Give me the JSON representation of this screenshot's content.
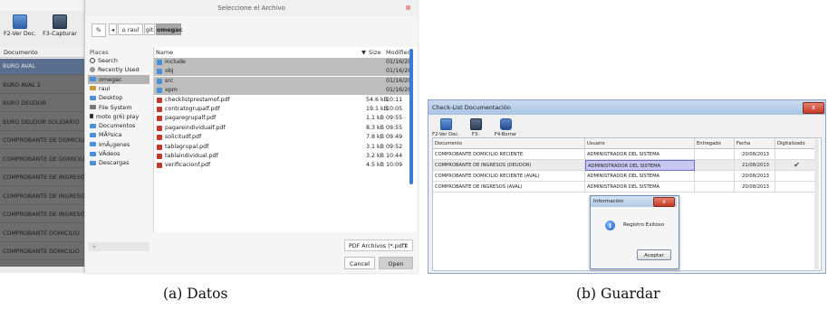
{
  "panel_a": {
    "app": {
      "toolbar": [
        {
          "label": "F2-Ver Doc.",
          "icon": "pdf-icon"
        },
        {
          "label": "F3-Capturar",
          "icon": "capture-icon"
        }
      ],
      "column": "Documento",
      "rows": [
        "BURO AVAL",
        "BURO AVAL 2",
        "BURO DEUDOR",
        "BURO DEUDOR SOLIDARIO",
        "COMPROBANTE DE DOMICILIO",
        "COMPROBANTE DE DOMICILIO",
        "COMPROBANTE DE INGRESOS",
        "COMPROBANTE DE INGRESOS",
        "COMPROBANTE DE INGRESOS",
        "COMPROBANTE DOMICILIO",
        "COMPROBANTE DOMICILIO"
      ],
      "selected_row": 0
    },
    "dialog": {
      "title": "Seleccione el Archivo",
      "breadcrumbs": [
        "raul",
        "git",
        "omegac"
      ],
      "places_header": "Places",
      "places": [
        {
          "label": "Search",
          "icon": "search-icon"
        },
        {
          "label": "Recently Used",
          "icon": "recent-icon"
        },
        {
          "label": "omegac",
          "icon": "folder-icon"
        },
        {
          "label": "raul",
          "icon": "home-icon"
        },
        {
          "label": "Desktop",
          "icon": "folder-icon"
        },
        {
          "label": "File System",
          "icon": "disk-icon"
        },
        {
          "label": "moto g(6) play",
          "icon": "phone-icon"
        },
        {
          "label": "Documentos",
          "icon": "folder-icon"
        },
        {
          "label": "MÃºsica",
          "icon": "folder-icon"
        },
        {
          "label": "ImÃ¡genes",
          "icon": "folder-icon"
        },
        {
          "label": "VÃ­deos",
          "icon": "folder-icon"
        },
        {
          "label": "Descargas",
          "icon": "folder-icon"
        }
      ],
      "selected_place": 2,
      "add_place": "+",
      "columns": {
        "name": "Name",
        "size": "Size",
        "modified": "Modified"
      },
      "files": [
        {
          "name": "include",
          "size": "",
          "modified": "01/16/20",
          "type": "dir"
        },
        {
          "name": "obj",
          "size": "",
          "modified": "01/16/20",
          "type": "dir"
        },
        {
          "name": "src",
          "size": "",
          "modified": "01/16/20",
          "type": "dir"
        },
        {
          "name": "xpm",
          "size": "",
          "modified": "01/16/20",
          "type": "dir"
        },
        {
          "name": "checklistprestamof.pdf",
          "size": "54.6 kB",
          "modified": "10:11",
          "type": "pdf"
        },
        {
          "name": "contratogrupalf.pdf",
          "size": "19.1 kB",
          "modified": "10:05",
          "type": "pdf"
        },
        {
          "name": "pagaregrupalf.pdf",
          "size": "1.1 kB",
          "modified": "09:55",
          "type": "pdf"
        },
        {
          "name": "pagareindividualf.pdf",
          "size": "8.3 kB",
          "modified": "09:55",
          "type": "pdf"
        },
        {
          "name": "solicitudf.pdf",
          "size": "7.8 kB",
          "modified": "09:49",
          "type": "pdf"
        },
        {
          "name": "tablagrupal.pdf",
          "size": "3.1 kB",
          "modified": "09:52",
          "type": "pdf"
        },
        {
          "name": "tablaindividual.pdf",
          "size": "3.2 kB",
          "modified": "10:44",
          "type": "pdf"
        },
        {
          "name": "verificacionf.pdf",
          "size": "4.5 kB",
          "modified": "10:09",
          "type": "pdf"
        }
      ],
      "filter": "PDF Archivos (*.pdf)",
      "cancel": "Cancel",
      "open": "Open"
    },
    "caption": "(a) Datos"
  },
  "panel_b": {
    "window_title": "Check-List Documentación",
    "close": "x",
    "toolbar": [
      {
        "label": "F2-Ver Doc.",
        "icon": "pdf-icon"
      },
      {
        "label": "F3-Capturar",
        "icon": "capture-icon"
      },
      {
        "label": "F4-Borrar",
        "icon": "delete-icon"
      }
    ],
    "columns": [
      "Documento",
      "Usuario",
      "Entregado",
      "Fecha",
      "Digitalizado"
    ],
    "rows": [
      {
        "documento": "COMPROBANTE DOMICILIO RECIENTE",
        "usuario": "ADMINISTRADOR DEL SISTEMA",
        "entregado": "",
        "fecha": "20/08/2013",
        "digitalizado": ""
      },
      {
        "documento": "COMPROBANTE DE INGRESOS (DEUDOR)",
        "usuario": "ADMINISTRADOR DEL SISTEMA",
        "entregado": "",
        "fecha": "21/08/2013",
        "digitalizado": "✔"
      },
      {
        "documento": "COMPROBANTE DOMICILIO RECIENTE (AVAL)",
        "usuario": "ADMINISTRADOR DEL SISTEMA",
        "entregado": "",
        "fecha": "20/08/2013",
        "digitalizado": ""
      },
      {
        "documento": "COMPROBANTE DE INGRESOS (AVAL)",
        "usuario": "ADMINISTRADOR DEL SISTEMA",
        "entregado": "",
        "fecha": "20/08/2013",
        "digitalizado": ""
      }
    ],
    "message_box": {
      "title": "Información",
      "message": "Registro Exitoso",
      "button": "Aceptar",
      "icon": "info-icon"
    },
    "caption": "(b) Guardar"
  }
}
